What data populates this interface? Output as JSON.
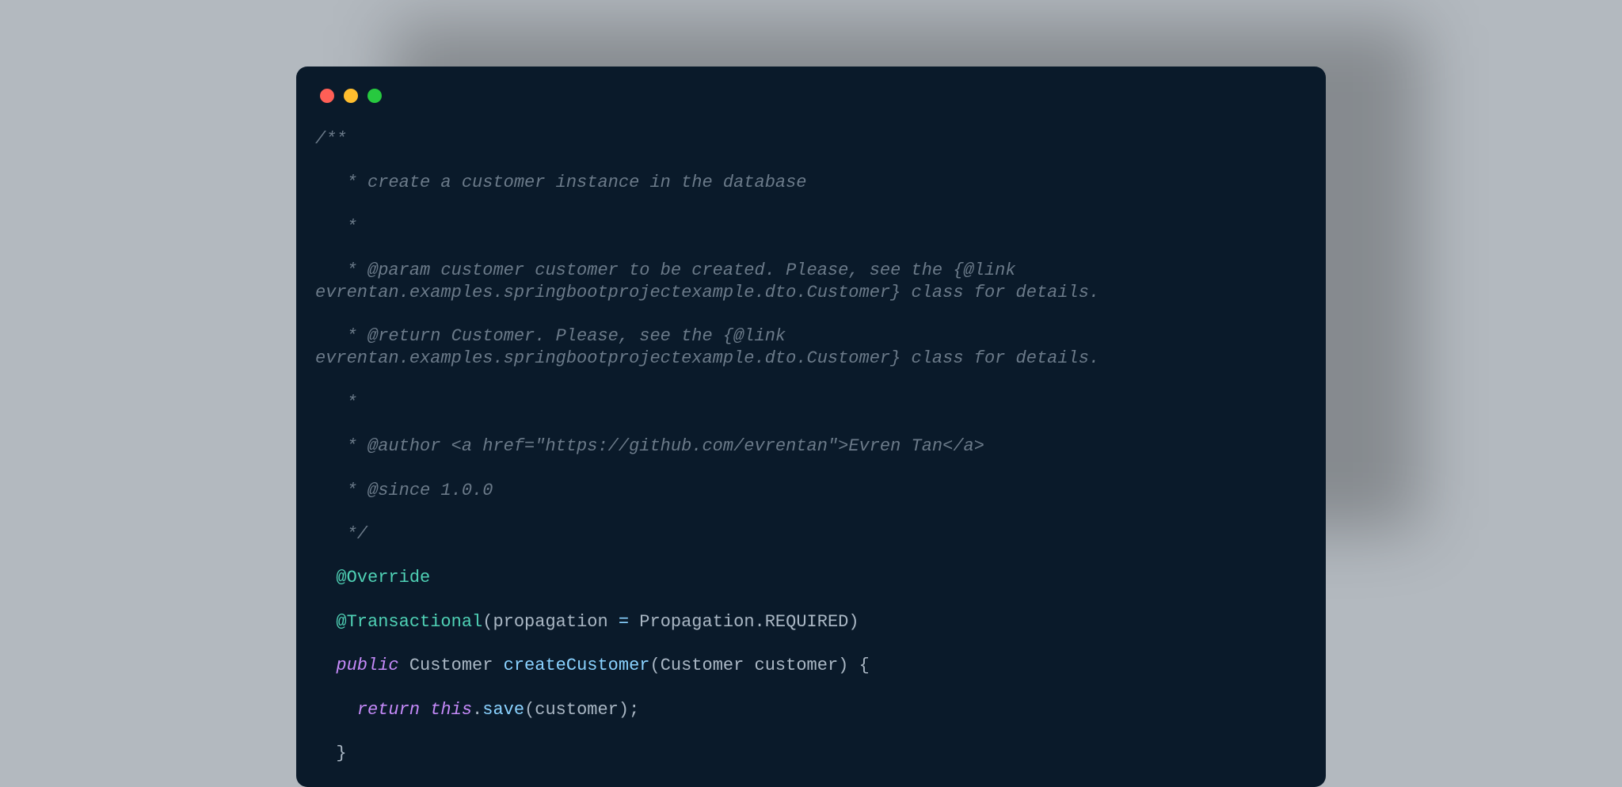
{
  "colors": {
    "bg_page": "#b3b9bf",
    "bg_window": "#0a1a2a",
    "red": "#ff5f56",
    "yellow": "#ffbd2e",
    "green": "#27c93f",
    "comment": "#6b7a89",
    "annotation": "#4fd1b5",
    "keyword": "#c58af9",
    "method": "#8ad2ff",
    "default_text": "#aab7c4"
  },
  "code": {
    "doc_open": "/**",
    "doc_l1": "   * create a customer instance in the database",
    "doc_blank1": "   *",
    "doc_param": "   * @param customer customer to be created. Please, see the {@link evrentan.examples.springbootprojectexample.dto.Customer} class for details.",
    "doc_return": "   * @return Customer. Please, see the {@link evrentan.examples.springbootprojectexample.dto.Customer} class for details.",
    "doc_blank2": "   *",
    "doc_author": "   * @author <a href=\"https://github.com/evrentan\">Evren Tan</a>",
    "doc_since": "   * @since 1.0.0",
    "doc_close": "   */",
    "ann_override": "  @Override",
    "ann_transactional_pre": "  ",
    "ann_transactional_at": "@Transactional",
    "ann_transactional_open": "(",
    "ann_transactional_lhs": "propagation ",
    "ann_transactional_eq": "=",
    "ann_transactional_rhs_pre": " Propagation",
    "ann_transactional_dot": ".",
    "ann_transactional_rhs": "REQUIRED",
    "ann_transactional_close": ")",
    "sig_indent": "  ",
    "sig_public": "public",
    "sig_space1": " ",
    "sig_type": "Customer",
    "sig_space2": " ",
    "sig_method": "createCustomer",
    "sig_open": "(",
    "sig_ptype": "Customer",
    "sig_pspace": " ",
    "sig_pname": "customer",
    "sig_close": ")",
    "sig_space3": " ",
    "sig_brace_open": "{",
    "body_indent": "    ",
    "body_return": "return",
    "body_space1": " ",
    "body_this": "this",
    "body_dot": ".",
    "body_save": "save",
    "body_open": "(",
    "body_arg": "customer",
    "body_close": ")",
    "body_semi": ";",
    "end_indent": "  ",
    "end_brace": "}"
  }
}
